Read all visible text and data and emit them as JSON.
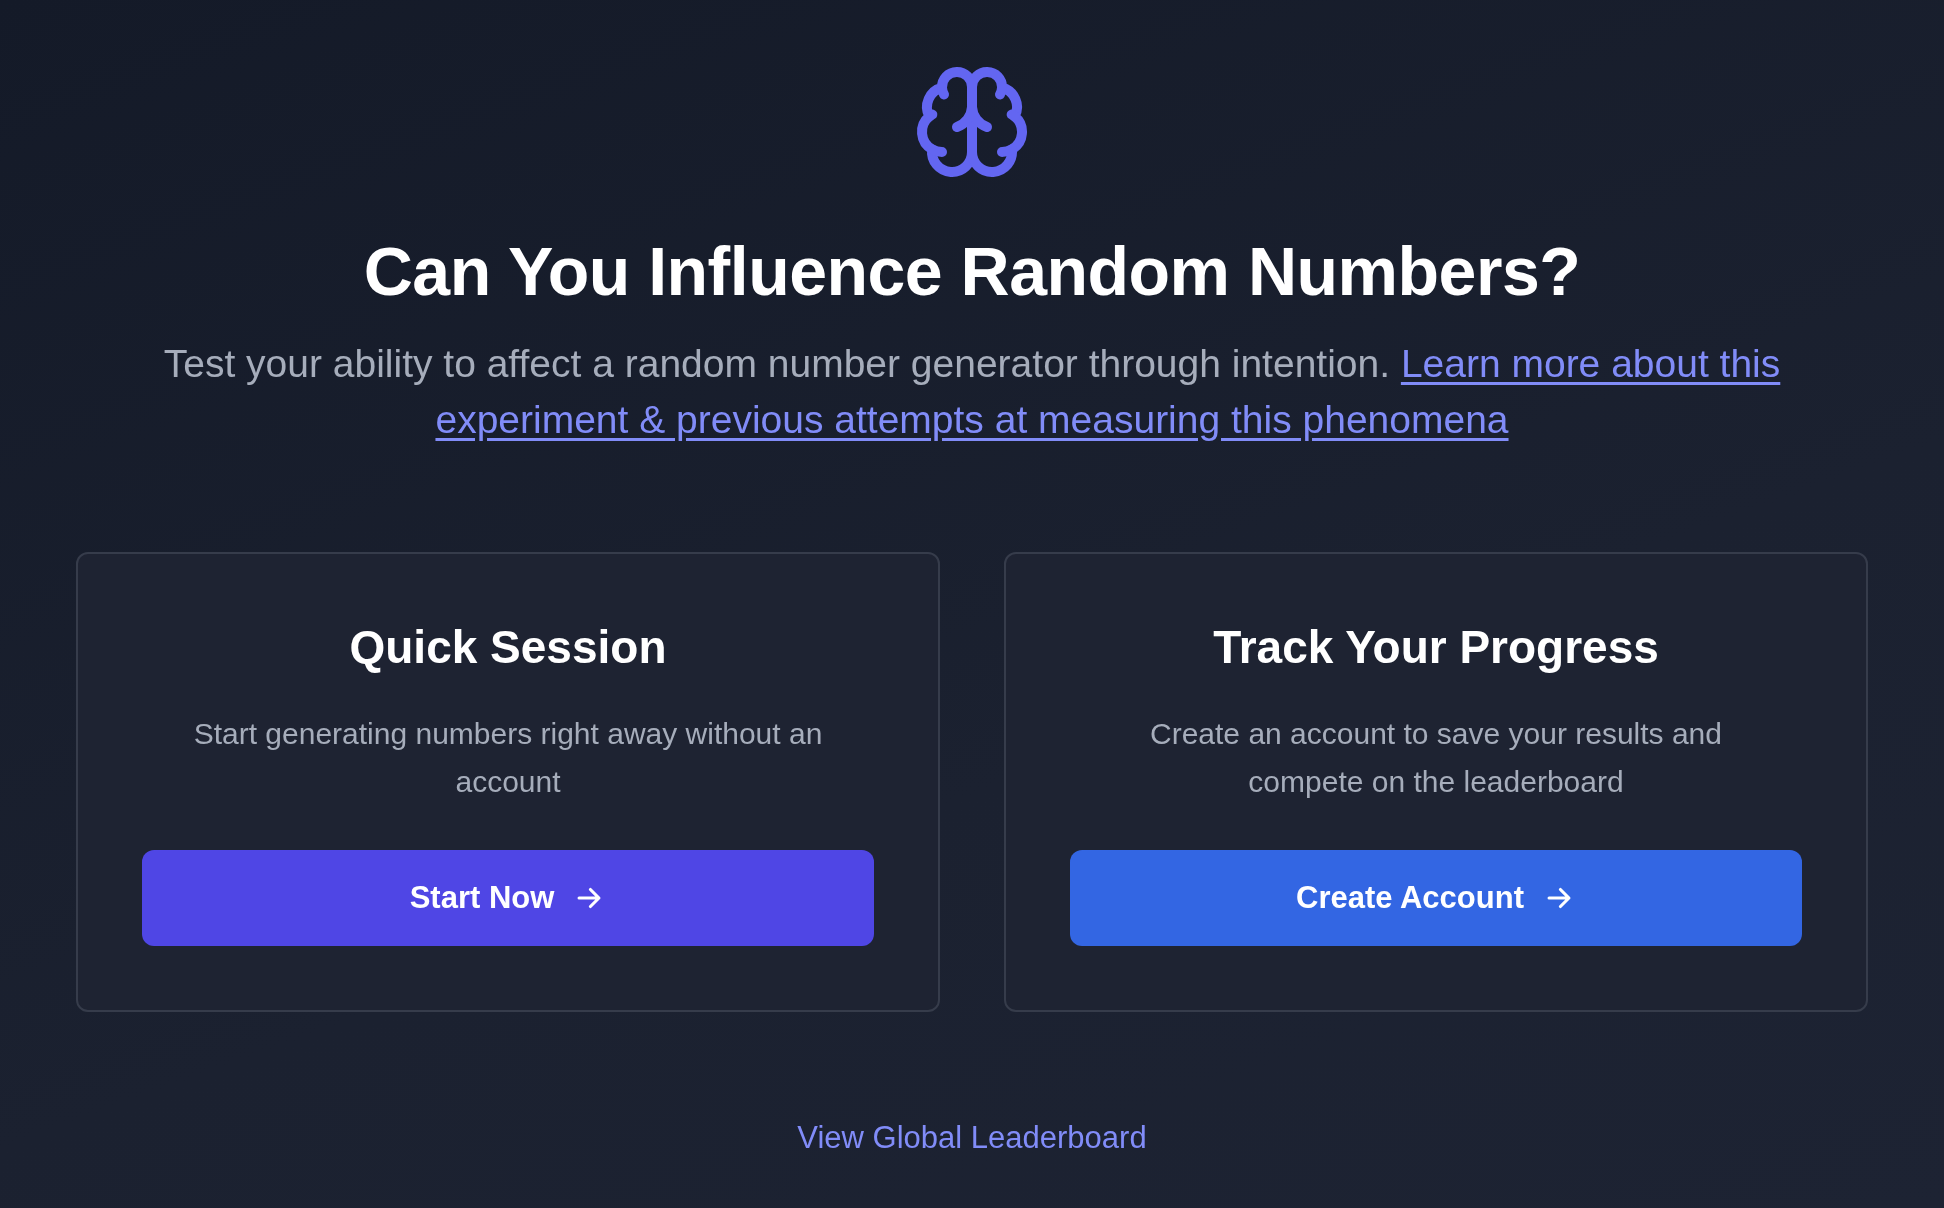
{
  "hero": {
    "title": "Can You Influence Random Numbers?",
    "subtitle": "Test your ability to affect a random number generator through intention.",
    "link_lines": [
      "Learn more about this",
      "experiment & previous attempts at measuring this phenomena"
    ]
  },
  "cards": [
    {
      "title": "Quick Session",
      "description": "Start generating numbers right away without an account",
      "button": {
        "label": "Start Now",
        "kind": "indigo"
      }
    },
    {
      "title": "Track Your Progress",
      "description": "Create an account to save your results and compete on the leaderboard",
      "button": {
        "label": "Create Account",
        "kind": "blue"
      }
    }
  ],
  "footer_link": "View Global Leaderboard"
}
